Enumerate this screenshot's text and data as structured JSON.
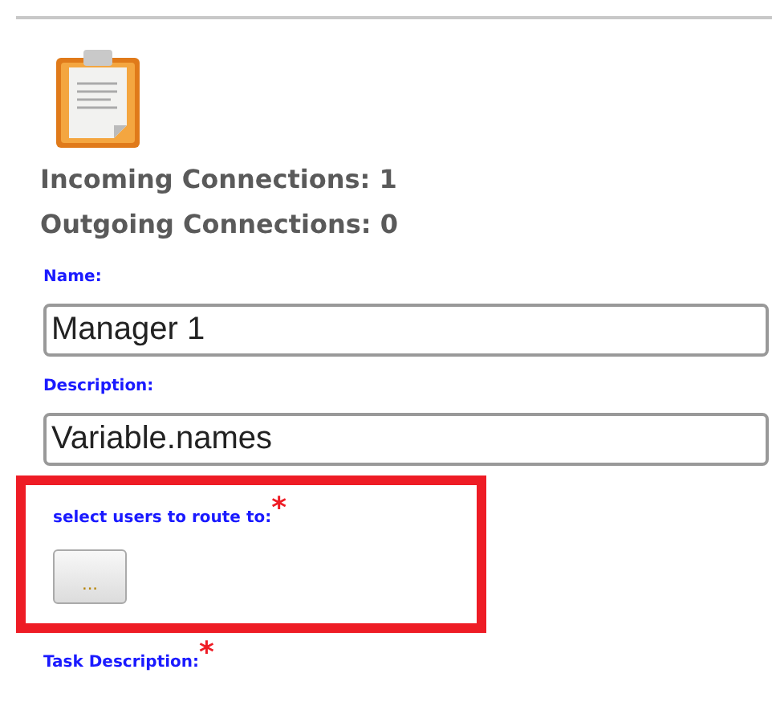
{
  "stats": [
    "Incoming Connections: 1",
    "Outgoing Connections: 0"
  ],
  "fields": [
    {
      "kind": "text",
      "label": "Name:",
      "value": "Manager 1"
    },
    {
      "kind": "text",
      "label": "Description:",
      "value": "Variable.names"
    },
    {
      "kind": "picker",
      "label": "select users to route to:",
      "required_mark": "*",
      "button": "...",
      "highlighted": true
    },
    {
      "kind": "label",
      "label": "Task Description:",
      "required_mark": "*"
    }
  ]
}
